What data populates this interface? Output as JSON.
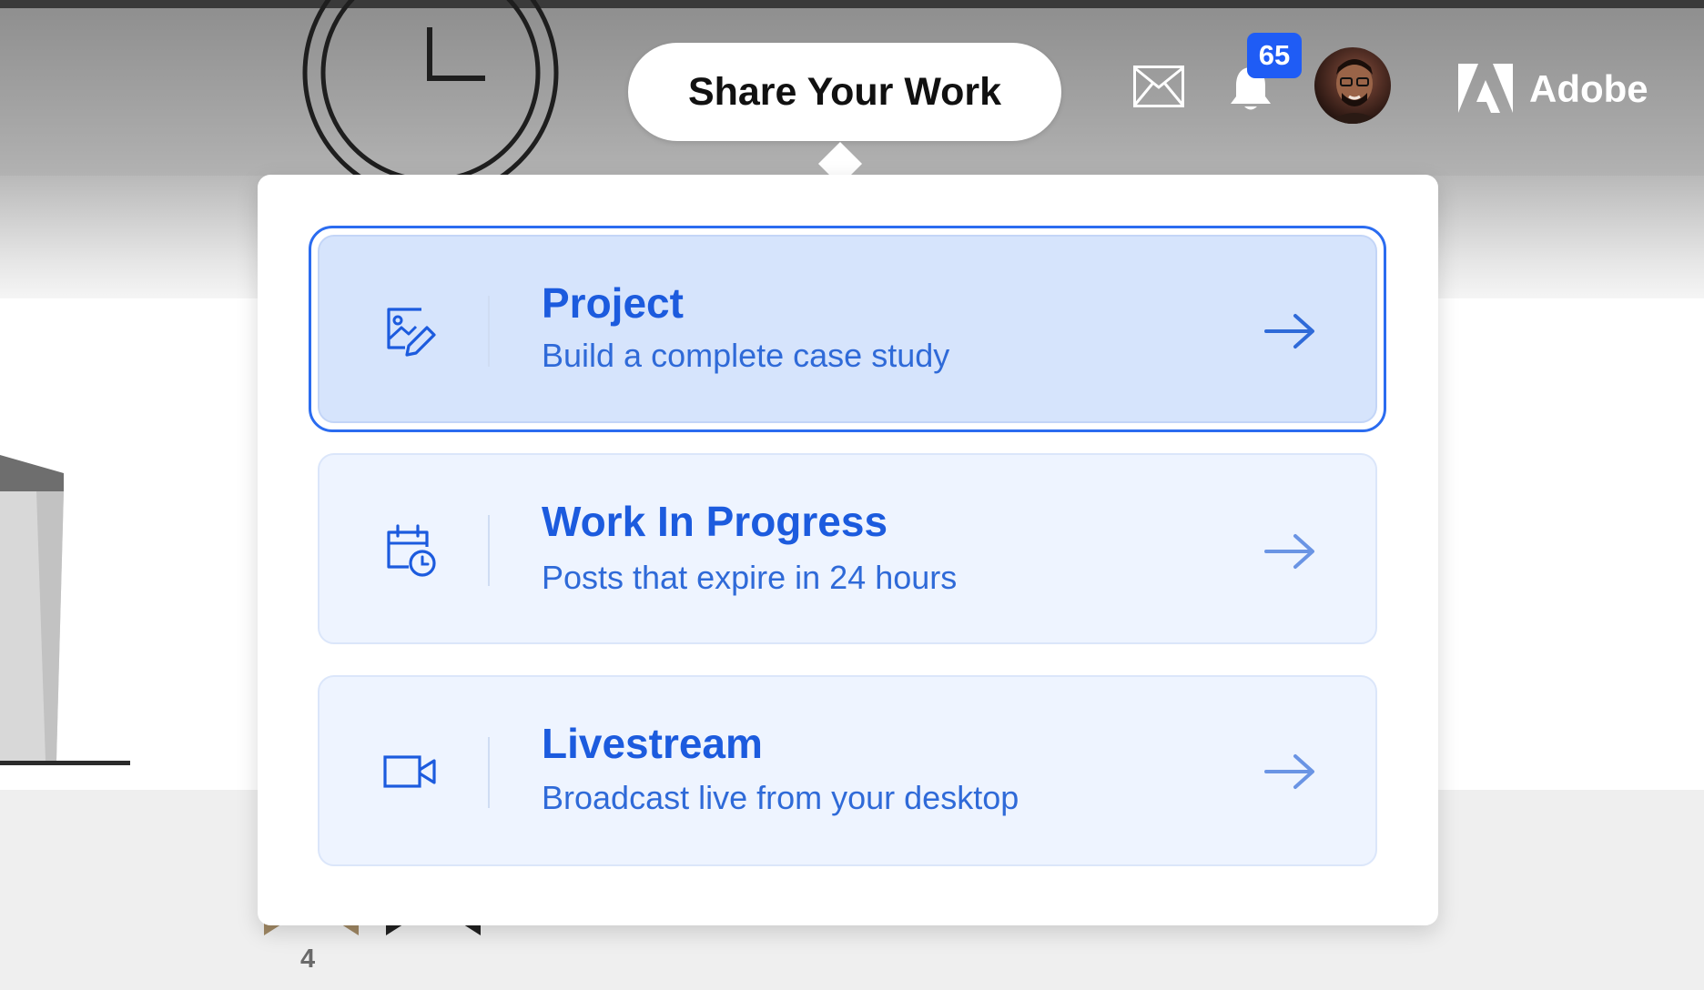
{
  "header": {
    "share_button_label": "Share Your Work",
    "notification_count": "65",
    "brand_name": "Adobe",
    "icons": [
      "envelope-icon",
      "bell-icon",
      "avatar",
      "adobe-logo-icon"
    ]
  },
  "share_menu": {
    "options": [
      {
        "title": "Project",
        "subtitle": "Build a complete case study",
        "icon": "image-edit-icon",
        "selected": true
      },
      {
        "title": "Work In Progress",
        "subtitle": "Posts that expire in 24 hours",
        "icon": "calendar-clock-icon",
        "selected": false
      },
      {
        "title": "Livestream",
        "subtitle": "Broadcast live from your desktop",
        "icon": "video-camera-icon",
        "selected": false
      }
    ]
  },
  "background": {
    "count_label": "4"
  },
  "colors": {
    "accent": "#1c5bde",
    "badge": "#1f5cf5",
    "selected_bg": "#d6e4fc",
    "option_bg": "#eef4ff"
  }
}
